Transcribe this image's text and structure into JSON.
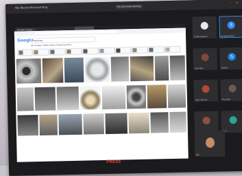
{
  "window": {
    "app_title": "Wa Reconciliaccounting",
    "share_label": "You are screen sharing"
  },
  "browser": {
    "tabs": [
      "Google Images",
      "",
      "",
      ""
    ],
    "logo": "Google",
    "search_text": "bearings",
    "nav_items": "All  Images  Videos  News  Shopping  More"
  },
  "participants": [
    {
      "name": "Dr Buckingham",
      "avatar_color": "#e8e8e8",
      "avatar_letter": ""
    },
    {
      "name": "Sandeep Kumar",
      "avatar_color": "#2d8cff",
      "avatar_letter": "S"
    },
    {
      "name": "Vinod Rao",
      "avatar_color": "#7a4a3a",
      "avatar_letter": ""
    },
    {
      "name": "Sujatha",
      "avatar_color": "#1e88e5",
      "avatar_letter": "S"
    },
    {
      "name": "Arjun Sharma",
      "avatar_color": "#b0493b",
      "avatar_letter": ""
    },
    {
      "name": "Priya Nair",
      "avatar_color": "#6a5a52",
      "avatar_letter": ""
    },
    {
      "name": "Kiran Patel",
      "avatar_color": "#8a5040",
      "avatar_letter": ""
    },
    {
      "name": "Ravi",
      "avatar_color": "#26a69a",
      "avatar_letter": ""
    }
  ],
  "self_view_name": "You",
  "bottom_text": "PRESS"
}
